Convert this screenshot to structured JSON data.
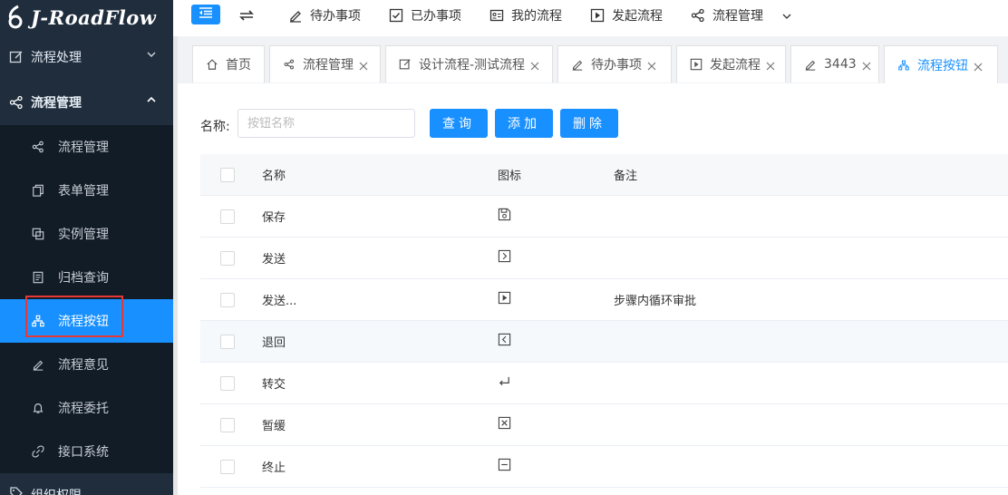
{
  "brand": {
    "name": "J-RoadFlow"
  },
  "sidebar": {
    "groups": [
      {
        "label": "流程处理",
        "icon": "edit-square-icon",
        "expanded": false
      },
      {
        "label": "流程管理",
        "icon": "share-icon",
        "expanded": true
      },
      {
        "label": "组织权限",
        "icon": "tag-icon",
        "expanded": false
      }
    ],
    "items": [
      {
        "label": "流程管理",
        "icon": "share-icon"
      },
      {
        "label": "表单管理",
        "icon": "copy-icon"
      },
      {
        "label": "实例管理",
        "icon": "layers-icon"
      },
      {
        "label": "归档查询",
        "icon": "archive-icon"
      },
      {
        "label": "流程按钮",
        "icon": "sitemap-icon",
        "active": true
      },
      {
        "label": "流程意见",
        "icon": "pen-icon"
      },
      {
        "label": "流程委托",
        "icon": "bell-icon"
      },
      {
        "label": "接口系统",
        "icon": "link-icon"
      }
    ]
  },
  "topnav": {
    "items": [
      {
        "label": "待办事项",
        "icon": "pen-icon"
      },
      {
        "label": "已办事项",
        "icon": "checkbox-icon"
      },
      {
        "label": "我的流程",
        "icon": "id-card-icon"
      },
      {
        "label": "发起流程",
        "icon": "play-square-icon"
      },
      {
        "label": "流程管理",
        "icon": "share-icon"
      }
    ],
    "more_icon": "chevron-down-icon"
  },
  "tabs": [
    {
      "label": "首页",
      "icon": "home-icon",
      "closable": false
    },
    {
      "label": "流程管理",
      "icon": "share-icon",
      "closable": true
    },
    {
      "label": "设计流程-测试流程",
      "icon": "edit-square-icon",
      "closable": true
    },
    {
      "label": "待办事项",
      "icon": "pen-icon",
      "closable": true
    },
    {
      "label": "发起流程",
      "icon": "play-square-icon",
      "closable": true
    },
    {
      "label": "3443",
      "icon": "pen-icon",
      "closable": true
    },
    {
      "label": "流程按钮",
      "icon": "sitemap-icon",
      "closable": true,
      "active": true
    }
  ],
  "search": {
    "label": "名称:",
    "placeholder": "按钮名称",
    "value": "",
    "query_label": "查询",
    "add_label": "添加",
    "delete_label": "删除"
  },
  "table": {
    "headers": {
      "name": "名称",
      "icon": "图标",
      "note": "备注"
    },
    "rows": [
      {
        "name": "保存",
        "icon": "save-icon",
        "note": ""
      },
      {
        "name": "发送",
        "icon": "caret-right-square-icon",
        "note": ""
      },
      {
        "name": "发送...",
        "icon": "play-square-icon",
        "note": "步骤内循环审批"
      },
      {
        "name": "退回",
        "icon": "caret-left-square-icon",
        "note": ""
      },
      {
        "name": "转交",
        "icon": "enter-icon",
        "note": ""
      },
      {
        "name": "暂缓",
        "icon": "close-square-icon",
        "note": ""
      },
      {
        "name": "终止",
        "icon": "minus-square-icon",
        "note": ""
      }
    ]
  },
  "colors": {
    "sidebar_bg": "#1f2d3d",
    "submenu_bg": "#121c27",
    "accent": "#1890ff",
    "highlight_border": "#e53935"
  }
}
